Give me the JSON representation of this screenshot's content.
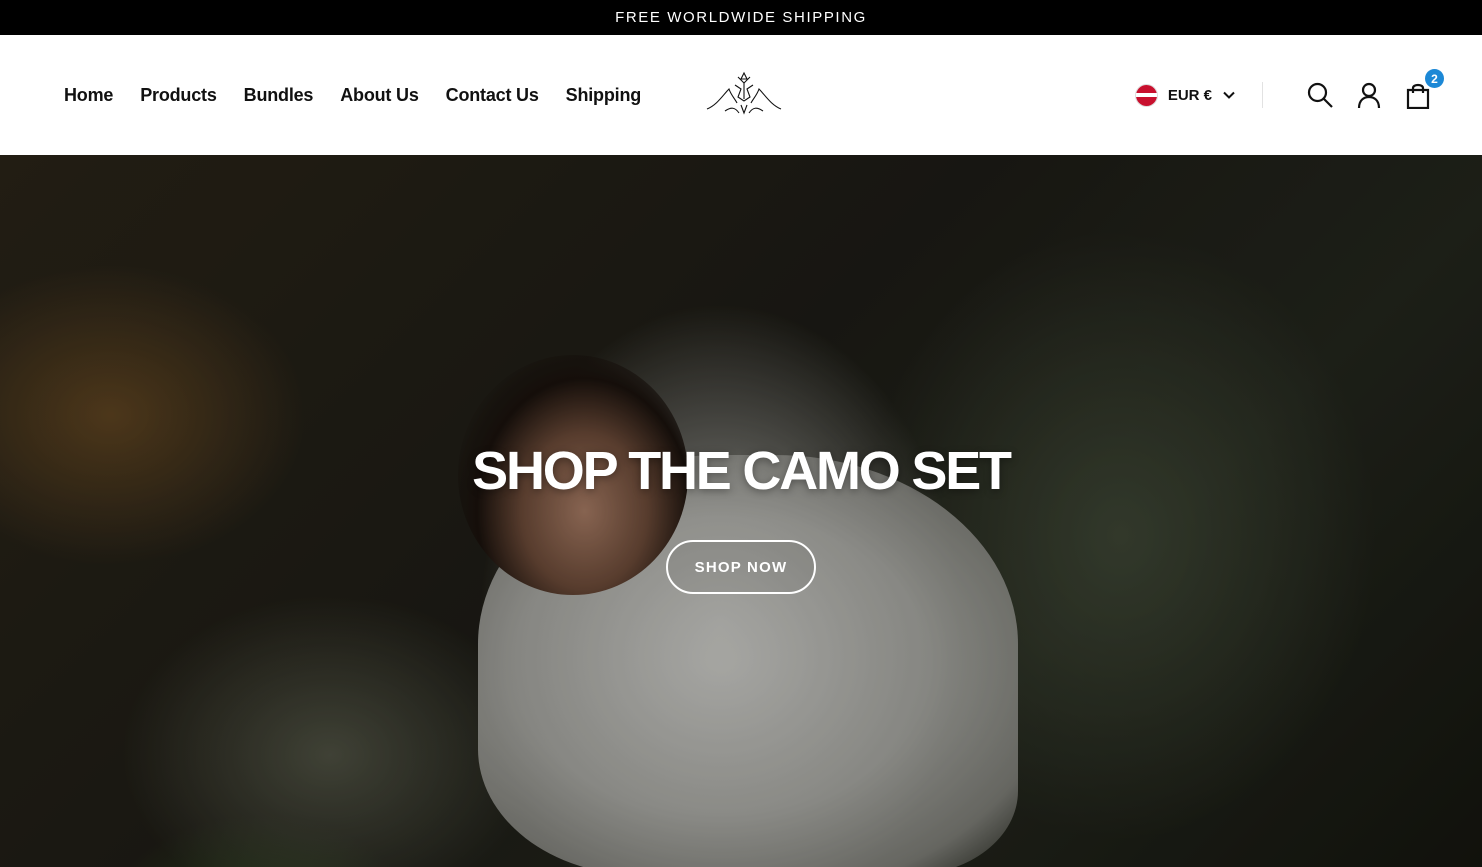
{
  "announcement": {
    "text": "FREE WORLDWIDE SHIPPING"
  },
  "nav": {
    "items": [
      {
        "label": "Home"
      },
      {
        "label": "Products"
      },
      {
        "label": "Bundles"
      },
      {
        "label": "About Us"
      },
      {
        "label": "Contact Us"
      },
      {
        "label": "Shipping"
      }
    ]
  },
  "header": {
    "logo_icon": "brand-logo-icon",
    "currency": {
      "label": "EUR €",
      "flag": "latvia-flag-icon"
    },
    "icons": {
      "search": "search-icon",
      "account": "user-icon",
      "cart": "shopping-bag-icon"
    },
    "cart_count": "2"
  },
  "hero": {
    "title": "SHOP THE CAMO SET",
    "button_label": "SHOP NOW",
    "image": "model-in-grey-hoodie-photo"
  },
  "colors": {
    "announcement_bg": "#000000",
    "badge": "#1c88d6",
    "text": "#111111"
  }
}
